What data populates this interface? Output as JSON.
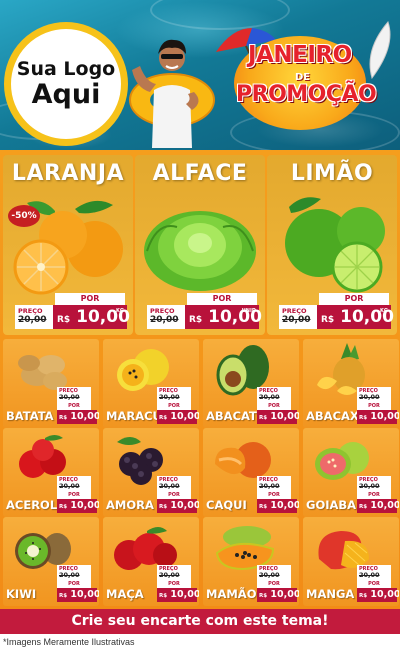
{
  "logo": {
    "line1": "Sua Logo",
    "line2": "Aqui"
  },
  "promo": {
    "line1": "JANEIRO",
    "line2": "DE",
    "line3": "PROMOÇÃO"
  },
  "featured": [
    {
      "name": "LARANJA",
      "badge": "-50%",
      "preco_label": "PREÇO",
      "old_price": "20,00",
      "por_label": "POR",
      "currency": "R$",
      "price": "10,00",
      "unit": "KG"
    },
    {
      "name": "ALFACE",
      "preco_label": "PREÇO",
      "old_price": "20,00",
      "por_label": "POR",
      "currency": "R$",
      "price": "10,00",
      "unit": "UNID"
    },
    {
      "name": "LIMÃO",
      "preco_label": "PREÇO",
      "old_price": "20,00",
      "por_label": "POR",
      "currency": "R$",
      "price": "10,00",
      "unit": "KG"
    }
  ],
  "products": [
    {
      "name": "BATATA",
      "preco_label": "PREÇO",
      "old_price": "20,00",
      "por_label": "POR",
      "currency": "R$",
      "price": "10,00"
    },
    {
      "name": "MARACUJÁ",
      "preco_label": "PREÇO",
      "old_price": "20,00",
      "por_label": "POR",
      "currency": "R$",
      "price": "10,00"
    },
    {
      "name": "ABACATE",
      "preco_label": "PREÇO",
      "old_price": "20,00",
      "por_label": "POR",
      "currency": "R$",
      "price": "10,00"
    },
    {
      "name": "ABACAXI",
      "preco_label": "PREÇO",
      "old_price": "20,00",
      "por_label": "POR",
      "currency": "R$",
      "price": "10,00"
    },
    {
      "name": "ACEROLA",
      "preco_label": "PREÇO",
      "old_price": "20,00",
      "por_label": "POR",
      "currency": "R$",
      "price": "10,00"
    },
    {
      "name": "AMORA",
      "preco_label": "PREÇO",
      "old_price": "20,00",
      "por_label": "POR",
      "currency": "R$",
      "price": "10,00"
    },
    {
      "name": "CAQUI",
      "preco_label": "PREÇO",
      "old_price": "20,00",
      "por_label": "POR",
      "currency": "R$",
      "price": "10,00"
    },
    {
      "name": "GOIABA",
      "preco_label": "PREÇO",
      "old_price": "20,00",
      "por_label": "POR",
      "currency": "R$",
      "price": "10,00"
    },
    {
      "name": "KIWI",
      "preco_label": "PREÇO",
      "old_price": "20,00",
      "por_label": "POR",
      "currency": "R$",
      "price": "10,00"
    },
    {
      "name": "MAÇA",
      "preco_label": "PREÇO",
      "old_price": "20,00",
      "por_label": "POR",
      "currency": "R$",
      "price": "10,00"
    },
    {
      "name": "MAMÃO",
      "preco_label": "PREÇO",
      "old_price": "20,00",
      "por_label": "POR",
      "currency": "R$",
      "price": "10,00"
    },
    {
      "name": "MANGA",
      "preco_label": "PREÇO",
      "old_price": "20,00",
      "por_label": "POR",
      "currency": "R$",
      "price": "10,00"
    }
  ],
  "cta": "Crie seu encarte com este tema!",
  "footer": "*Imagens Meramente Ilustrativas",
  "colors": {
    "accent": "#c21b3d",
    "background": "#f59e1d",
    "pool": "#127996",
    "title": "#e6222c"
  }
}
